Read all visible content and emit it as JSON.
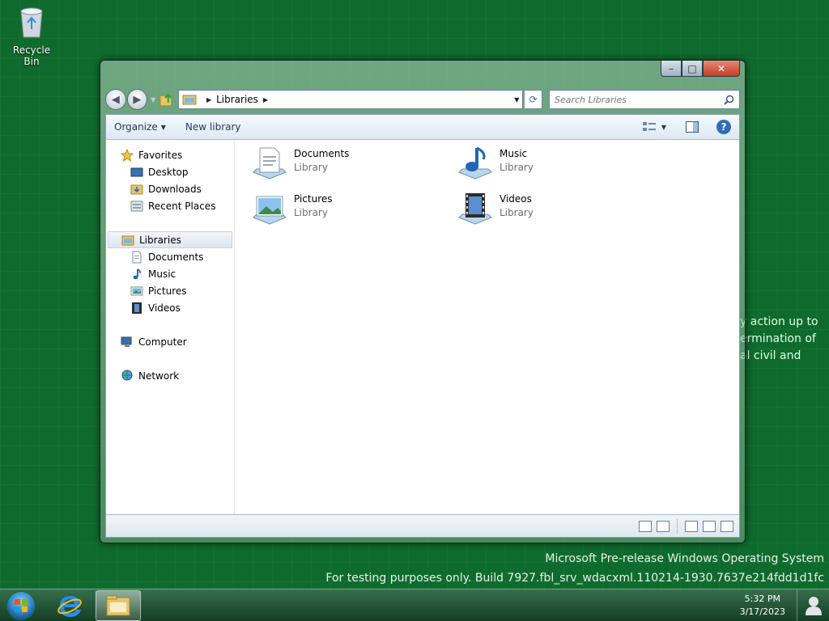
{
  "desktop": {
    "recycle_bin_label": "Recycle Bin",
    "background_lines": [
      "y action up to",
      "ermination of",
      "al civil and"
    ],
    "watermark_line1": "Microsoft Pre-release Windows Operating System",
    "watermark_line2": "For testing purposes only. Build 7927.fbl_srv_wdacxml.110214-1930.7637e214fdd1d1fc"
  },
  "window": {
    "caption": {
      "minimize": "–",
      "maximize": "□",
      "close": "✕"
    },
    "address": {
      "crumb": "Libraries"
    },
    "search": {
      "placeholder": "Search Libraries"
    },
    "command_bar": {
      "organize": "Organize",
      "new_library": "New library"
    },
    "nav_pane": {
      "favorites": "Favorites",
      "favorites_items": [
        "Desktop",
        "Downloads",
        "Recent Places"
      ],
      "libraries": "Libraries",
      "libraries_items": [
        "Documents",
        "Music",
        "Pictures",
        "Videos"
      ],
      "computer": "Computer",
      "network": "Network"
    },
    "libraries": [
      {
        "name": "Documents",
        "type": "Library",
        "icon": "documents-library-icon"
      },
      {
        "name": "Music",
        "type": "Library",
        "icon": "music-library-icon"
      },
      {
        "name": "Pictures",
        "type": "Library",
        "icon": "pictures-library-icon"
      },
      {
        "name": "Videos",
        "type": "Library",
        "icon": "videos-library-icon"
      }
    ]
  },
  "taskbar": {
    "time": "5:32 PM",
    "date": "3/17/2023"
  },
  "colors": {
    "desktop_green": "#0f6b2d",
    "accent_blue": "#2f6db5",
    "text_gray": "#6d6d6d"
  }
}
